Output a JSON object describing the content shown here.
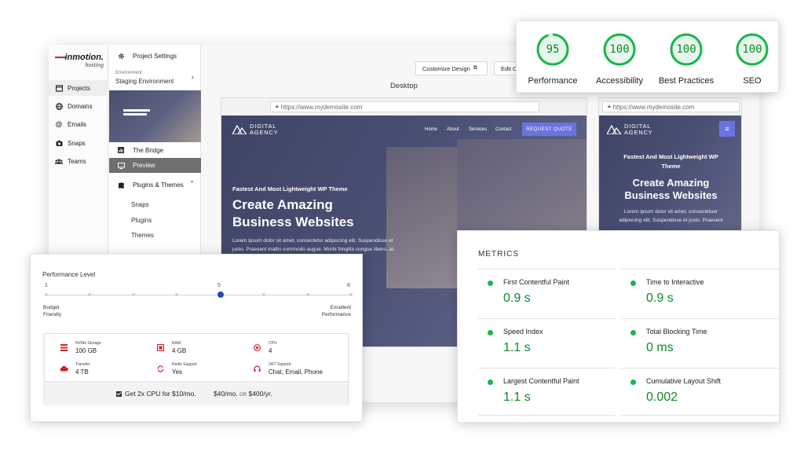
{
  "brand": {
    "name": "inmotion.",
    "sub": "hosting"
  },
  "nav": [
    {
      "label": "Projects",
      "icon": "square-icon"
    },
    {
      "label": "Domains",
      "icon": "globe-icon"
    },
    {
      "label": "Emails",
      "icon": "at-icon"
    },
    {
      "label": "Snaps",
      "icon": "camera-icon"
    },
    {
      "label": "Teams",
      "icon": "users-icon"
    }
  ],
  "sidebar": {
    "project_settings": "Project Settings",
    "env_label": "Environment",
    "env_value": "Staging Environment",
    "bridge": "The Bridge",
    "preview": "Preview",
    "plugins_themes": "Plugins & Themes",
    "sub_items": [
      "Snaps",
      "Plugins",
      "Themes"
    ]
  },
  "toolbar": {
    "customize": "Customize Design",
    "edit": "Edit C"
  },
  "preview": {
    "view_label": "Desktop",
    "url": "https://www.mydemosite.com",
    "site": {
      "brand_line1": "DIGITAL",
      "brand_line2": "AGENCY",
      "menu": [
        "Home",
        "About",
        "Services",
        "Contact"
      ],
      "cta": "REQUEST QUOTE",
      "tagline": "Fastest And Most Lightweight WP Theme",
      "headline_line1": "Create Amazing",
      "headline_line2": "Business Websites",
      "body_desktop_1": "Lorem ipsum dolor sit amet, consectetur adipiscing elit. Suspendisse et",
      "body_desktop_2": "justo. Praesent mattis commodo augue. Morbi fringilla congue libero, ac",
      "mobile_tagline_1": "Fastest And Most Lightweight WP",
      "mobile_tagline_2": "Theme",
      "mobile_body_1": "Lorem ipsum dolor sit amet, consectetuer",
      "mobile_body_2": "adipiscing elit. Suspendisse et justo. Praesent"
    }
  },
  "scores": [
    {
      "value": "95",
      "label": "Performance",
      "score": 0.95
    },
    {
      "value": "100",
      "label": "Accessibility",
      "score": 1.0
    },
    {
      "value": "100",
      "label": "Best Practices",
      "score": 1.0
    },
    {
      "value": "100",
      "label": "SEO",
      "score": 1.0
    }
  ],
  "performance": {
    "title": "Performance Level",
    "min": "1",
    "mid": "5",
    "max": "8",
    "level": 5,
    "low_label_1": "Budget",
    "low_label_2": "Friendly",
    "high_label_1": "Excellent",
    "high_label_2": "Performance",
    "specs": [
      {
        "label": "NVMe Storage",
        "value": "100 GB",
        "icon": "storage-icon"
      },
      {
        "label": "RAM",
        "value": "4 GB",
        "icon": "ram-icon"
      },
      {
        "label": "CPU",
        "value": "4",
        "icon": "cpu-icon"
      },
      {
        "label": "Transfer",
        "value": "4 TB",
        "icon": "cloud-icon"
      },
      {
        "label": "Redis Support",
        "value": "Yes",
        "icon": "redis-icon"
      },
      {
        "label": "24/7 Support",
        "value": "Chat, Email, Phone",
        "icon": "headset-icon"
      }
    ],
    "upsell": "Get 2x CPU for $10/mo.",
    "price_monthly": "$40/mo.",
    "price_or": "OR",
    "price_yearly": "$400/yr."
  },
  "metrics": {
    "title": "METRICS",
    "items": [
      {
        "label": "First Contentful Paint",
        "value": "0.9 s"
      },
      {
        "label": "Time to Interactive",
        "value": "0.9 s"
      },
      {
        "label": "Speed Index",
        "value": "1.1 s"
      },
      {
        "label": "Total Blocking Time",
        "value": "0 ms"
      },
      {
        "label": "Largest Contentful Paint",
        "value": "1.1 s"
      },
      {
        "label": "Cumulative Layout Shift",
        "value": "0.002"
      }
    ]
  },
  "colors": {
    "accent": "#6a74e0",
    "good": "#0c8a2b",
    "good_dot": "#18b749",
    "brand_red": "#c9252c"
  }
}
